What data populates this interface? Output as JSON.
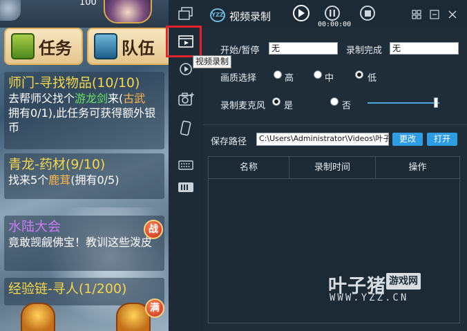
{
  "game": {
    "top_number": "100",
    "tabs": {
      "task": "任务",
      "team": "队伍"
    },
    "quests": [
      {
        "title": "师门-寻找物品(10/10)",
        "desc_a": "去帮师父找个",
        "desc_item": "游龙剑",
        "desc_b": "来(",
        "desc_extra": "古武",
        "desc_c": "拥有0/1),此任务可获得额外银币"
      },
      {
        "title": "青龙-药材(9/10)",
        "desc_a": "找来5个",
        "desc_item": "鹿茸",
        "desc_b": "(拥有0/5)"
      },
      {
        "title": "水陆大会",
        "desc_a": "竟敢觊觎佛宝！教训这些泼皮"
      },
      {
        "title": "经验链-寻人(1/200)"
      }
    ],
    "badges": {
      "battle": "战",
      "full": "满"
    }
  },
  "sidebar": {
    "tooltip": "视频录制",
    "icons": [
      "window-icon",
      "video-record-icon",
      "live-icon",
      "screenshot-icon",
      "phone-icon",
      "keyboard-icon",
      "gamepad-icon"
    ]
  },
  "titlebar": {
    "logo": "YZZ",
    "title": "视频录制",
    "timer": "00:00:00"
  },
  "settings": {
    "start_pause_label": "开始/暂停",
    "start_pause_value": "无",
    "done_label": "录制完成",
    "done_value": "无",
    "quality_label": "画质选择",
    "quality_options": [
      "高",
      "中",
      "低"
    ],
    "quality_selected": "低",
    "mic_label": "录制麦克风",
    "mic_options": [
      "是",
      "否"
    ],
    "mic_selected": "是",
    "mic_volume": 0.95
  },
  "save": {
    "label": "保存路径",
    "path": "C:\\Users\\Administrator\\Videos\\叶子猪",
    "change_label": "更改",
    "open_label": "打开"
  },
  "table": {
    "columns": [
      "名称",
      "录制时间",
      "操作"
    ],
    "rows": []
  },
  "watermark": {
    "main": "叶子猪",
    "badge": "游戏网",
    "url": "WWW.YZZ.CN"
  },
  "colors": {
    "accent": "#2f9de3",
    "highlight_red": "#e3222a",
    "panel_bg": "#1e2d38"
  }
}
